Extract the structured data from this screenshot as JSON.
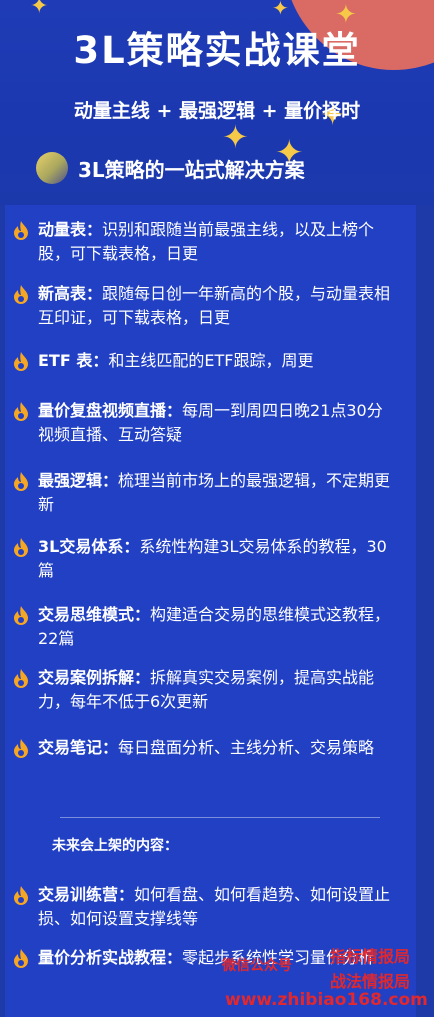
{
  "header": {
    "title": "3L策略实战课堂",
    "slogan": "动量主线 + 最强逻辑 + 量价择时",
    "subtitle": "3L策略的一站式解决方案"
  },
  "items": [
    {
      "name": "动量表：",
      "desc": "识别和跟随当前最强主线，以及上榜个股，可下载表格，日更"
    },
    {
      "name": "新高表：",
      "desc": "跟随每日创一年新高的个股，与动量表相互印证，可下载表格，日更"
    },
    {
      "name": "ETF 表：",
      "desc": "和主线匹配的ETF跟踪，周更"
    },
    {
      "name": "量价复盘视频直播：",
      "desc": "每周一到周四日晚21点30分视频直播、互动答疑"
    },
    {
      "name": "最强逻辑：",
      "desc": "梳理当前市场上的最强逻辑，不定期更新"
    },
    {
      "name": "3L交易体系：",
      "desc": "系统性构建3L交易体系的教程，30篇"
    },
    {
      "name": "交易思维模式：",
      "desc": "构建适合交易的思维模式这教程，22篇"
    },
    {
      "name": "交易案例拆解：",
      "desc": "拆解真实交易案例，提高实战能力，每年不低于6次更新"
    },
    {
      "name": "交易笔记：",
      "desc": "每日盘面分析、主线分析、交易策略"
    }
  ],
  "future_label": "未来会上架的内容：",
  "future_items": [
    {
      "name": "交易训练营：",
      "desc": "如何看盘、如何看趋势、如何设置止损、如何设置支撑线等"
    },
    {
      "name": "量价分析实战教程：",
      "desc": "零起步系统性学习量价分析"
    }
  ],
  "watermark": {
    "line1": "微信公众号",
    "line2": "指标情报局",
    "line3": "战法情报局",
    "site": "www.zhibiao168.com"
  },
  "colors": {
    "background": "#1d3aa8",
    "panel": "#2140c4",
    "star": "#f7c948",
    "flame": "#f5a623",
    "watermark": "#e0282e"
  }
}
